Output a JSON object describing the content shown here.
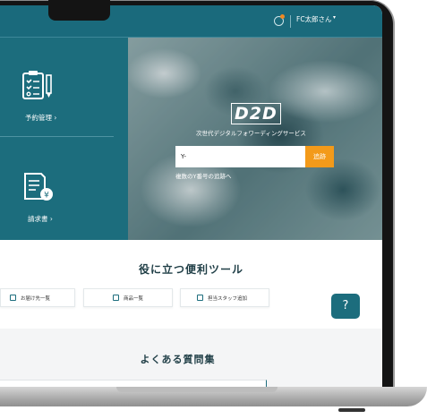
{
  "header": {
    "user_name": "FC太郎さん",
    "caret": "▾"
  },
  "tiles": [
    {
      "label": "予約管理 ›",
      "icon": "clipboard-checklist-icon"
    },
    {
      "label": "請求書 ›",
      "icon": "invoice-yen-icon"
    }
  ],
  "hero": {
    "logo": "D2D",
    "tagline": "次世代デジタルフォワーディングサービス",
    "track_value": "Y-",
    "track_button": "追跡",
    "multi_link": "複数のY番号の追跡へ"
  },
  "tools": {
    "title": "役に立つ便利ツール",
    "items": [
      {
        "label": "お届け先一覧"
      },
      {
        "label": "商品一覧"
      },
      {
        "label": "担当スタッフ追加"
      }
    ]
  },
  "help_button": "?",
  "faq": {
    "title": "よくある質問集"
  },
  "colors": {
    "brand_teal": "#1c6d7d",
    "accent_orange": "#f39a1a"
  }
}
